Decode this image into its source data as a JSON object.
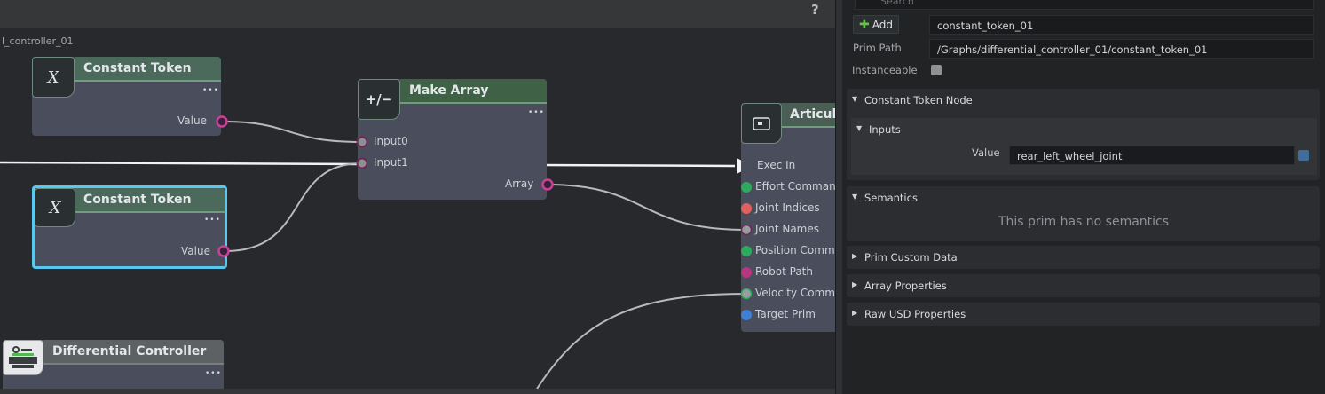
{
  "graph": {
    "breadcrumb": "l_controller_01",
    "help_label": "?",
    "nodes": {
      "constant_token_1": {
        "title": "Constant Token",
        "icon": "variable-x-icon",
        "icon_glyph": "X",
        "more": "•••",
        "port": "Value"
      },
      "constant_token_2": {
        "title": "Constant Token",
        "icon": "variable-x-icon",
        "icon_glyph": "X",
        "more": "•••",
        "port": "Value"
      },
      "make_array": {
        "title": "Make Array",
        "icon": "plus-minus-icon",
        "icon_glyph": "+/−",
        "more": "•••",
        "inputs": [
          "Input0",
          "Input1"
        ],
        "output": "Array"
      },
      "articulation": {
        "title": "Articula",
        "icon": "articulation-icon",
        "ports": [
          "Exec In",
          "Effort Comman",
          "Joint Indices",
          "Joint Names",
          "Position Comm",
          "Robot Path",
          "Velocity Comm",
          "Target Prim"
        ]
      },
      "differential_controller": {
        "title": "Differential Controller",
        "icon": "robot-icon",
        "more": "•••"
      }
    }
  },
  "props": {
    "search_placeholder": "Search",
    "add_label": "Add",
    "name_value": "constant_token_01",
    "prim_path_label": "Prim Path",
    "prim_path_value": "/Graphs/differential_controller_01/constant_token_01",
    "instanceable_label": "Instanceable",
    "sections": {
      "constant_token_node": "Constant Token Node",
      "inputs": "Inputs",
      "value_label": "Value",
      "value": "rear_left_wheel_joint",
      "semantics": "Semantics",
      "no_semantics": "This prim has no semantics",
      "prim_custom_data": "Prim Custom Data",
      "array_properties": "Array Properties",
      "raw_usd_properties": "Raw USD Properties"
    }
  },
  "colors": {
    "selection": "#58c8ee",
    "port_magenta": "#c8409a",
    "port_green": "#2eaa5e",
    "port_red": "#e35e5e",
    "port_blue": "#3f7fd6",
    "port_gray": "#9a9ca0"
  }
}
